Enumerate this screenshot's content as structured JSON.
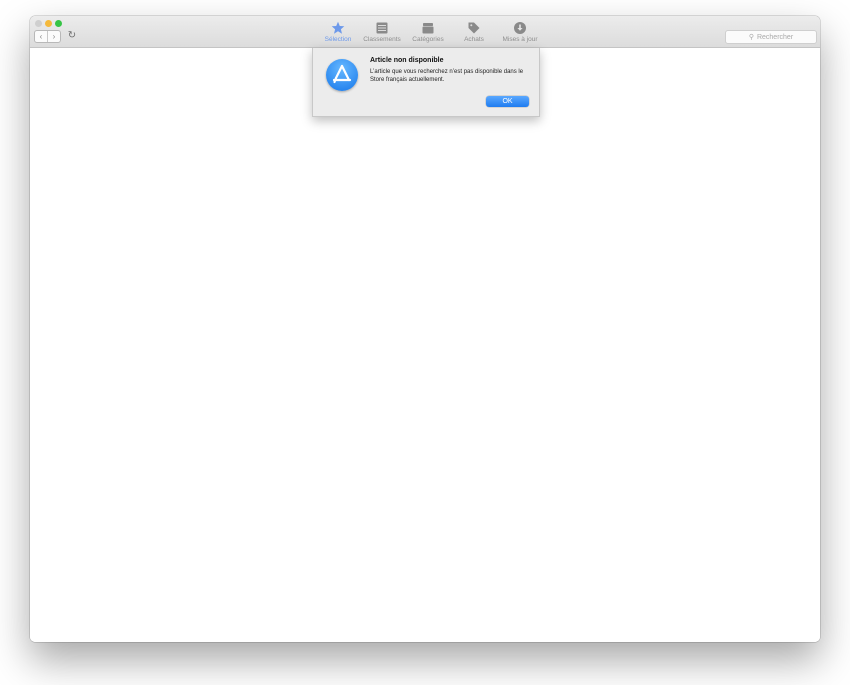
{
  "window": {
    "nav": {
      "back_icon": "‹",
      "forward_icon": "›",
      "reload_icon": "↻"
    },
    "tabs": [
      {
        "label": "Sélection",
        "icon": "star-icon",
        "active": true
      },
      {
        "label": "Classements",
        "icon": "list-icon",
        "active": false
      },
      {
        "label": "Catégories",
        "icon": "box-icon",
        "active": false
      },
      {
        "label": "Achats",
        "icon": "tag-icon",
        "active": false
      },
      {
        "label": "Mises à jour",
        "icon": "download-icon",
        "active": false
      }
    ],
    "search": {
      "placeholder": "Rechercher",
      "icon": "magnifier-icon"
    }
  },
  "alert": {
    "title": "Article non disponible",
    "message": "L’article que vous recherchez n’est pas disponible dans le Store français actuellement.",
    "ok_label": "OK",
    "icon": "app-store-icon"
  },
  "colors": {
    "accent": "#1f7cf0",
    "active_tab": "#6d99ea",
    "close": "#cfcfcf",
    "minimize": "#f5b93b",
    "maximize": "#36c445"
  }
}
